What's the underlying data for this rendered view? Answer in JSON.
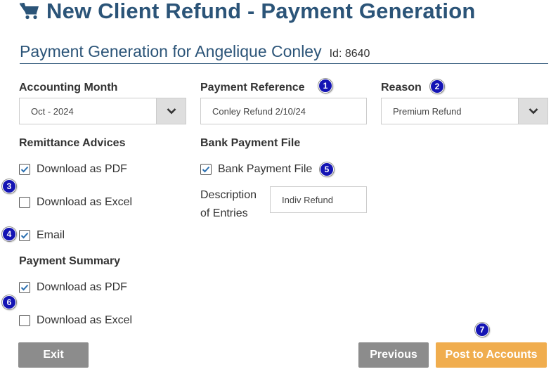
{
  "header": {
    "title": "New Client Refund - Payment Generation",
    "subtitle": "Payment Generation for Angelique Conley",
    "id_label": "Id: 8640"
  },
  "accounting_month": {
    "label": "Accounting Month",
    "value": "Oct - 2024"
  },
  "payment_reference": {
    "label": "Payment Reference",
    "value": "Conley Refund 2/10/24"
  },
  "reason": {
    "label": "Reason",
    "value": "Premium Refund"
  },
  "remittance_advices": {
    "label": "Remittance Advices",
    "download_pdf": {
      "label": "Download as PDF",
      "checked": true
    },
    "download_excel": {
      "label": "Download as Excel",
      "checked": false
    },
    "email": {
      "label": "Email",
      "checked": true
    }
  },
  "bank_payment_file": {
    "label": "Bank Payment File",
    "checkbox": {
      "label": "Bank Payment File",
      "checked": true
    },
    "description_label_line1": "Description",
    "description_label_line2": "of Entries",
    "description_value": "Indiv Refund"
  },
  "payment_summary": {
    "label": "Payment Summary",
    "download_pdf": {
      "label": "Download as PDF",
      "checked": true
    },
    "download_excel": {
      "label": "Download as Excel",
      "checked": false
    }
  },
  "badges": [
    "1",
    "2",
    "3",
    "4",
    "5",
    "6",
    "7"
  ],
  "buttons": {
    "exit": "Exit",
    "previous": "Previous",
    "post": "Post to Accounts"
  },
  "colors": {
    "title": "#2b5478",
    "badge": "#1414b4",
    "grey_button": "#8c8c8c",
    "orange_button": "#f0ad4e",
    "check": "#2a6fb0"
  }
}
